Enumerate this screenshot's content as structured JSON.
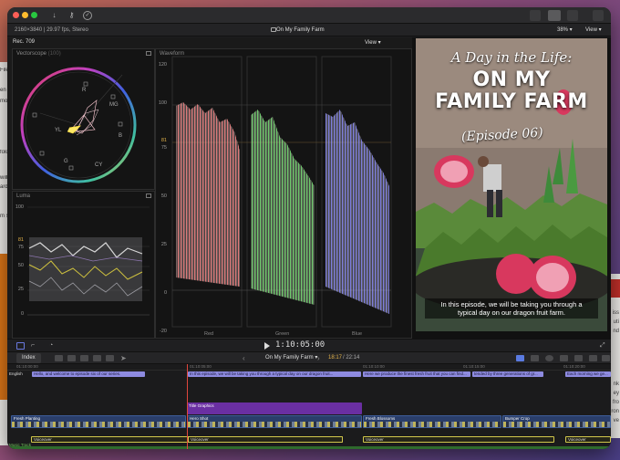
{
  "background_window_left": {
    "snippets": [
      "Files",
      "en",
      "mo",
      "fold",
      "will",
      "ards",
      "m sh"
    ]
  },
  "background_window_right": {
    "snippets": [
      "iss",
      "uti",
      "nd",
      "nk",
      "ey",
      "fro",
      "ron",
      "ve"
    ]
  },
  "infobar": {
    "spec": "2160×3840 | 29.97 fps, Stereo",
    "project_title": "On My Family Farm",
    "zoom": "38%",
    "view": "View"
  },
  "scopes": {
    "color_space": "Rec. 709",
    "view": "View",
    "vectorscope_label": "Vectorscope",
    "vectorscope_zoom": "(100)",
    "vectorscope_targets": [
      "R",
      "MG",
      "B",
      "CY",
      "G",
      "YL"
    ],
    "luma_label": "Luma",
    "waveform_label": "Waveform",
    "waveform_scale": [
      "120",
      "100",
      "81",
      "75",
      "50",
      "25",
      "0",
      "-20"
    ],
    "luma_scale": [
      "100",
      "81",
      "75",
      "50",
      "25",
      "0"
    ],
    "channels": [
      "Red",
      "Green",
      "Blue"
    ]
  },
  "viewer": {
    "poster_line1": "A Day in the Life:",
    "poster_line2": "ON MY",
    "poster_line3": "FAMILY FARM",
    "poster_line4": "(Episode 06)",
    "caption_line1": "In this episode, we will be taking you through a",
    "caption_line2": "typical day on our dragon fruit farm."
  },
  "transport": {
    "timecode": "1:10:05:00"
  },
  "timeline_header": {
    "index": "Index",
    "project_name": "On My Family Farm",
    "duration_current": "18:17",
    "duration_total": "/ 22:14"
  },
  "timeline": {
    "ruler": [
      "01:10:00:00",
      "01:10:05:00",
      "01:10:10:00",
      "01:10:15:00",
      "01:10:20:00"
    ],
    "caption_lane": "English",
    "captions": [
      "Hello, and welcome to episode six of our series.",
      "In this episode, we will be taking you through a typical day on our dragon fruit...",
      "Here we produce the finest fresh fruit that you can find...",
      "tended by three generations of gr...",
      "Each morning we ge..."
    ],
    "title_clip": "Title Graphics",
    "video_clips": [
      "Fresh Planting",
      "Hero Shot",
      "Fresh Blossoms",
      "Bumper Crop"
    ],
    "audio_clips": [
      "Voiceover",
      "Voiceover",
      "Voiceover",
      "Voiceover"
    ],
    "music_track": "Music Track"
  }
}
